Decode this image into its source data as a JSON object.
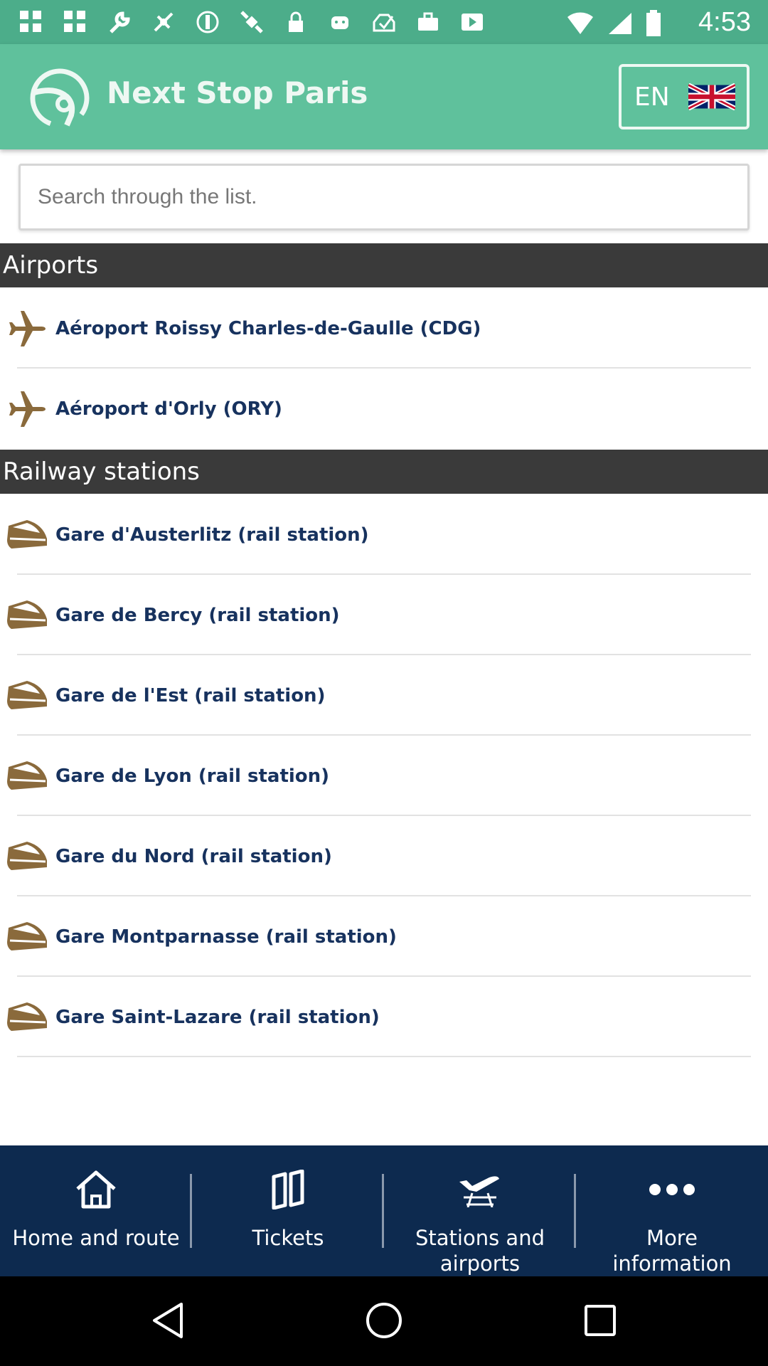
{
  "status_bar": {
    "time": "4:53",
    "icons": [
      "app-grid-icon",
      "app-grid-icon",
      "wrench-icon",
      "fake-gps-icon",
      "do-not-disturb-icon",
      "satellite-icon",
      "lock-icon",
      "android-icon",
      "inbox-icon",
      "briefcase-icon",
      "play-icon"
    ]
  },
  "app_bar": {
    "title": "Next Stop Paris",
    "language_code": "EN",
    "flag_icon": "uk-flag-icon"
  },
  "search": {
    "placeholder": "Search through the list."
  },
  "sections": {
    "airports": {
      "title": "Airports",
      "items": [
        {
          "label": "Aéroport Roissy Charles-de-Gaulle (CDG)",
          "icon": "plane-icon"
        },
        {
          "label": "Aéroport d'Orly (ORY)",
          "icon": "plane-icon"
        }
      ]
    },
    "railway": {
      "title": "Railway stations",
      "items": [
        {
          "label": "Gare d'Austerlitz (rail station)",
          "icon": "train-icon"
        },
        {
          "label": "Gare de Bercy (rail station)",
          "icon": "train-icon"
        },
        {
          "label": "Gare de l'Est (rail station)",
          "icon": "train-icon"
        },
        {
          "label": "Gare de Lyon (rail station)",
          "icon": "train-icon"
        },
        {
          "label": "Gare du Nord (rail station)",
          "icon": "train-icon"
        },
        {
          "label": "Gare Montparnasse (rail station)",
          "icon": "train-icon"
        },
        {
          "label": "Gare Saint-Lazare (rail station)",
          "icon": "train-icon"
        }
      ]
    }
  },
  "bottom_nav": [
    {
      "label": "Home and route",
      "icon": "home-icon"
    },
    {
      "label": "Tickets",
      "icon": "ticket-icon"
    },
    {
      "label": "Stations and\nairports",
      "icon": "plane-rail-icon"
    },
    {
      "label": "More\ninformation",
      "icon": "more-dots-icon"
    }
  ],
  "colors": {
    "app_bar": "#5fc19c",
    "status_bar": "#4cad8a",
    "section_header": "#3a3a3a",
    "item_text": "#17325e",
    "bottom_nav": "#0d2a4f",
    "icon_brown": "#8a6a3c"
  }
}
